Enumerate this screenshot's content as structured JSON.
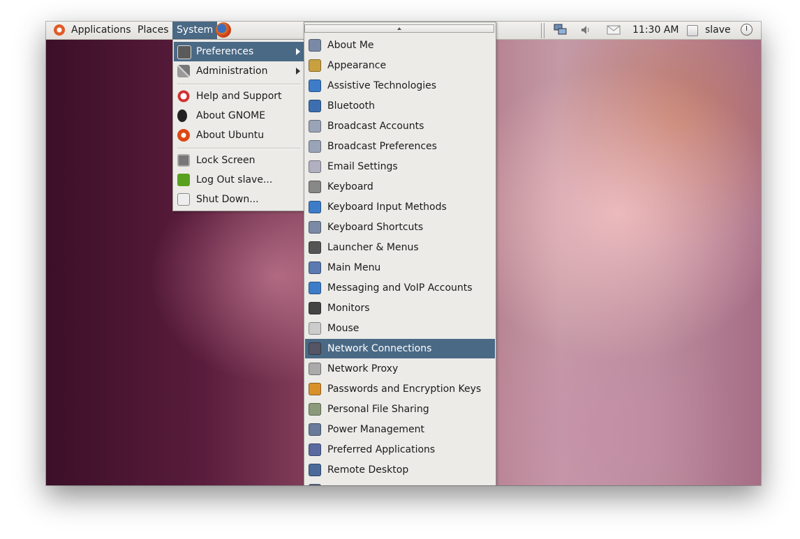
{
  "panel": {
    "menus": [
      "Applications",
      "Places",
      "System"
    ],
    "clock": "11:30 AM",
    "user": "slave"
  },
  "system_menu": {
    "items": [
      {
        "label": "Preferences",
        "icon": "preferences-icon",
        "submenu": true,
        "highlighted": true
      },
      {
        "label": "Administration",
        "icon": "administration-icon",
        "submenu": true
      },
      {
        "label": "Help and Support",
        "icon": "help-icon"
      },
      {
        "label": "About GNOME",
        "icon": "gnome-foot-icon"
      },
      {
        "label": "About Ubuntu",
        "icon": "ubuntu-icon"
      },
      {
        "label": "Lock Screen",
        "icon": "lock-screen-icon"
      },
      {
        "label": "Log Out slave...",
        "icon": "logout-icon"
      },
      {
        "label": "Shut Down...",
        "icon": "shutdown-icon"
      }
    ]
  },
  "preferences_menu": {
    "items": [
      {
        "label": "About Me",
        "icon": "about-me-icon"
      },
      {
        "label": "Appearance",
        "icon": "appearance-icon"
      },
      {
        "label": "Assistive Technologies",
        "icon": "accessibility-icon"
      },
      {
        "label": "Bluetooth",
        "icon": "bluetooth-icon"
      },
      {
        "label": "Broadcast Accounts",
        "icon": "broadcast-icon"
      },
      {
        "label": "Broadcast Preferences",
        "icon": "broadcast-icon"
      },
      {
        "label": "Email Settings",
        "icon": "email-settings-icon"
      },
      {
        "label": "Keyboard",
        "icon": "keyboard-icon"
      },
      {
        "label": "Keyboard Input Methods",
        "icon": "input-methods-icon"
      },
      {
        "label": "Keyboard Shortcuts",
        "icon": "keyboard-shortcuts-icon"
      },
      {
        "label": "Launcher & Menus",
        "icon": "launcher-icon"
      },
      {
        "label": "Main Menu",
        "icon": "main-menu-icon"
      },
      {
        "label": "Messaging and VoIP Accounts",
        "icon": "messaging-icon"
      },
      {
        "label": "Monitors",
        "icon": "monitor-icon"
      },
      {
        "label": "Mouse",
        "icon": "mouse-icon"
      },
      {
        "label": "Network Connections",
        "icon": "network-icon",
        "highlighted": true
      },
      {
        "label": "Network Proxy",
        "icon": "proxy-icon"
      },
      {
        "label": "Passwords and Encryption Keys",
        "icon": "keys-icon"
      },
      {
        "label": "Personal File Sharing",
        "icon": "file-sharing-icon"
      },
      {
        "label": "Power Management",
        "icon": "power-management-icon"
      },
      {
        "label": "Preferred Applications",
        "icon": "preferred-apps-icon"
      },
      {
        "label": "Remote Desktop",
        "icon": "remote-desktop-icon"
      }
    ]
  }
}
